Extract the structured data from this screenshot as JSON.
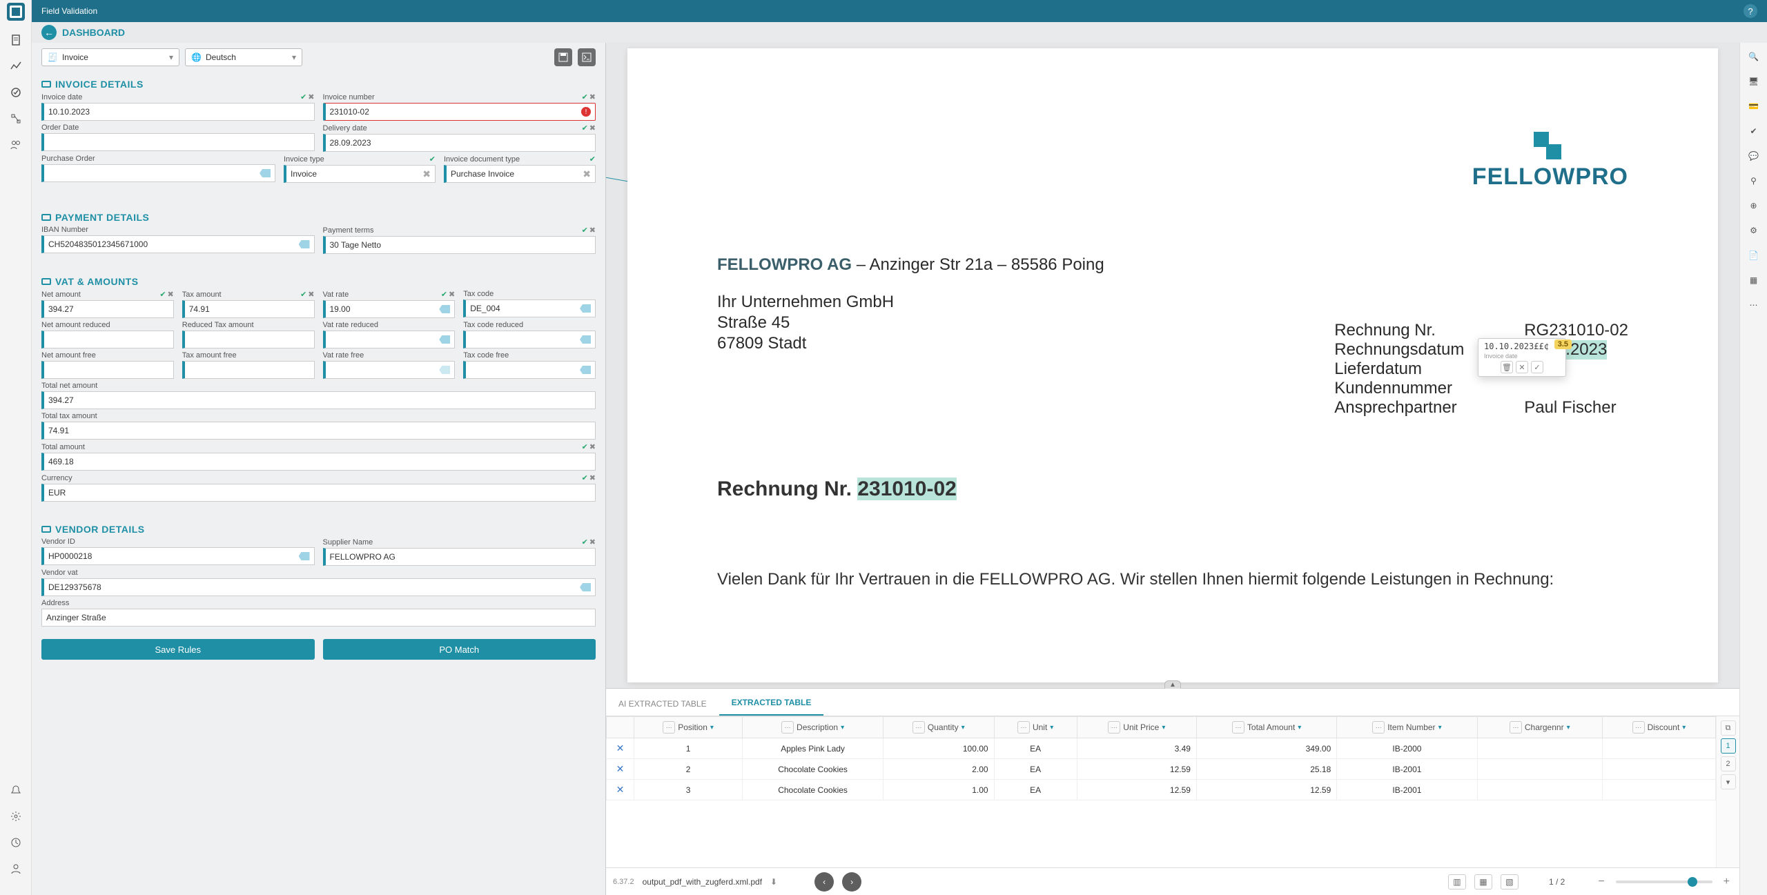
{
  "header": {
    "title": "Field Validation"
  },
  "breadcrumb": {
    "label": "DASHBOARD"
  },
  "toolbar": {
    "doc_type": "Invoice",
    "language": "Deutsch"
  },
  "sections": {
    "invoice": {
      "title": "INVOICE DETAILS",
      "fields": {
        "invoice_date": {
          "label": "Invoice date",
          "value": "10.10.2023"
        },
        "invoice_number": {
          "label": "Invoice number",
          "value": "231010-02"
        },
        "order_date": {
          "label": "Order Date",
          "value": ""
        },
        "delivery_date": {
          "label": "Delivery date",
          "value": "28.09.2023"
        },
        "purchase_order": {
          "label": "Purchase Order",
          "value": ""
        },
        "invoice_type": {
          "label": "Invoice type",
          "value": "Invoice"
        },
        "invoice_doc_type": {
          "label": "Invoice document type",
          "value": "Purchase Invoice"
        }
      }
    },
    "payment": {
      "title": "PAYMENT DETAILS",
      "fields": {
        "iban": {
          "label": "IBAN Number",
          "value": "CH5204835012345671000"
        },
        "terms": {
          "label": "Payment terms",
          "value": "30 Tage Netto"
        }
      }
    },
    "vat": {
      "title": "VAT & AMOUNTS",
      "fields": {
        "net_amount": {
          "label": "Net amount",
          "value": "394.27"
        },
        "tax_amount": {
          "label": "Tax amount",
          "value": "74.91"
        },
        "vat_rate": {
          "label": "Vat rate",
          "value": "19.00"
        },
        "tax_code": {
          "label": "Tax code",
          "value": "DE_004"
        },
        "net_amount_reduced": {
          "label": "Net amount reduced",
          "value": ""
        },
        "reduced_tax_amount": {
          "label": "Reduced Tax amount",
          "value": ""
        },
        "vat_rate_reduced": {
          "label": "Vat rate reduced",
          "value": ""
        },
        "tax_code_reduced": {
          "label": "Tax code reduced",
          "value": ""
        },
        "net_amount_free": {
          "label": "Net amount free",
          "value": ""
        },
        "tax_amount_free": {
          "label": "Tax amount free",
          "value": ""
        },
        "vat_rate_free": {
          "label": "Vat rate free",
          "value": ""
        },
        "tax_code_free": {
          "label": "Tax code free",
          "value": ""
        },
        "total_net_amount": {
          "label": "Total net amount",
          "value": "394.27"
        },
        "total_tax_amount": {
          "label": "Total tax amount",
          "value": "74.91"
        },
        "total_amount": {
          "label": "Total amount",
          "value": "469.18"
        },
        "currency": {
          "label": "Currency",
          "value": "EUR"
        }
      }
    },
    "vendor": {
      "title": "VENDOR DETAILS",
      "fields": {
        "vendor_id": {
          "label": "Vendor ID",
          "value": "HP0000218"
        },
        "supplier_name": {
          "label": "Supplier Name",
          "value": "FELLOWPRO AG"
        },
        "vendor_vat": {
          "label": "Vendor vat",
          "value": "DE129375678"
        },
        "address": {
          "label": "Address",
          "value": "Anzinger Straße"
        }
      }
    }
  },
  "actions": {
    "save_rules": "Save Rules",
    "po_match": "PO Match"
  },
  "document": {
    "supplier_line": "FELLOWPRO AG – Anzinger Str 21a – 85586 Poing",
    "supplier_name": "FELLOWPRO AG",
    "customer": {
      "name": "Ihr Unternehmen GmbH",
      "street": "Straße 45",
      "city": "67809 Stadt"
    },
    "meta": {
      "rechnung_nr_label": "Rechnung Nr.",
      "rechnung_nr": "RG231010-02",
      "rechnungsdatum_label": "Rechnungsdatum",
      "rechnungsdatum": "10.10.2023",
      "lieferdatum_label": "Lieferdatum",
      "kundennummer_label": "Kundennummer",
      "ansprechpartner_label": "Ansprechpartner",
      "ansprechpartner": "Paul Fischer"
    },
    "title_prefix": "Rechnung Nr. ",
    "title_number": "231010-02",
    "intro": "Vielen Dank für Ihr Vertrauen in die FELLOWPRO AG. Wir stellen Ihnen hiermit folgende Leistungen in Rechnung:",
    "tooltip": {
      "value": "10.10.2023££¢",
      "label": "Invoice date",
      "score": "3.5"
    }
  },
  "table": {
    "tabs": {
      "ai": "AI EXTRACTED TABLE",
      "extracted": "EXTRACTED TABLE"
    },
    "columns": [
      "Position",
      "Description",
      "Quantity",
      "Unit",
      "Unit Price",
      "Total Amount",
      "Item Number",
      "Chargennr",
      "Discount"
    ],
    "rows": [
      {
        "pos": "1",
        "desc": "Apples Pink Lady",
        "qty": "100.00",
        "unit": "EA",
        "price": "3.49",
        "total": "349.00",
        "item": "IB-2000",
        "charge": "",
        "disc": ""
      },
      {
        "pos": "2",
        "desc": "Chocolate Cookies",
        "qty": "2.00",
        "unit": "EA",
        "price": "12.59",
        "total": "25.18",
        "item": "IB-2001",
        "charge": "",
        "disc": ""
      },
      {
        "pos": "3",
        "desc": "Chocolate Cookies",
        "qty": "1.00",
        "unit": "EA",
        "price": "12.59",
        "total": "12.59",
        "item": "IB-2001",
        "charge": "",
        "disc": ""
      }
    ]
  },
  "footer": {
    "version": "6.37.2",
    "filename": "output_pdf_with_zugferd.xml.pdf",
    "page_indicator": "1 / 2"
  }
}
